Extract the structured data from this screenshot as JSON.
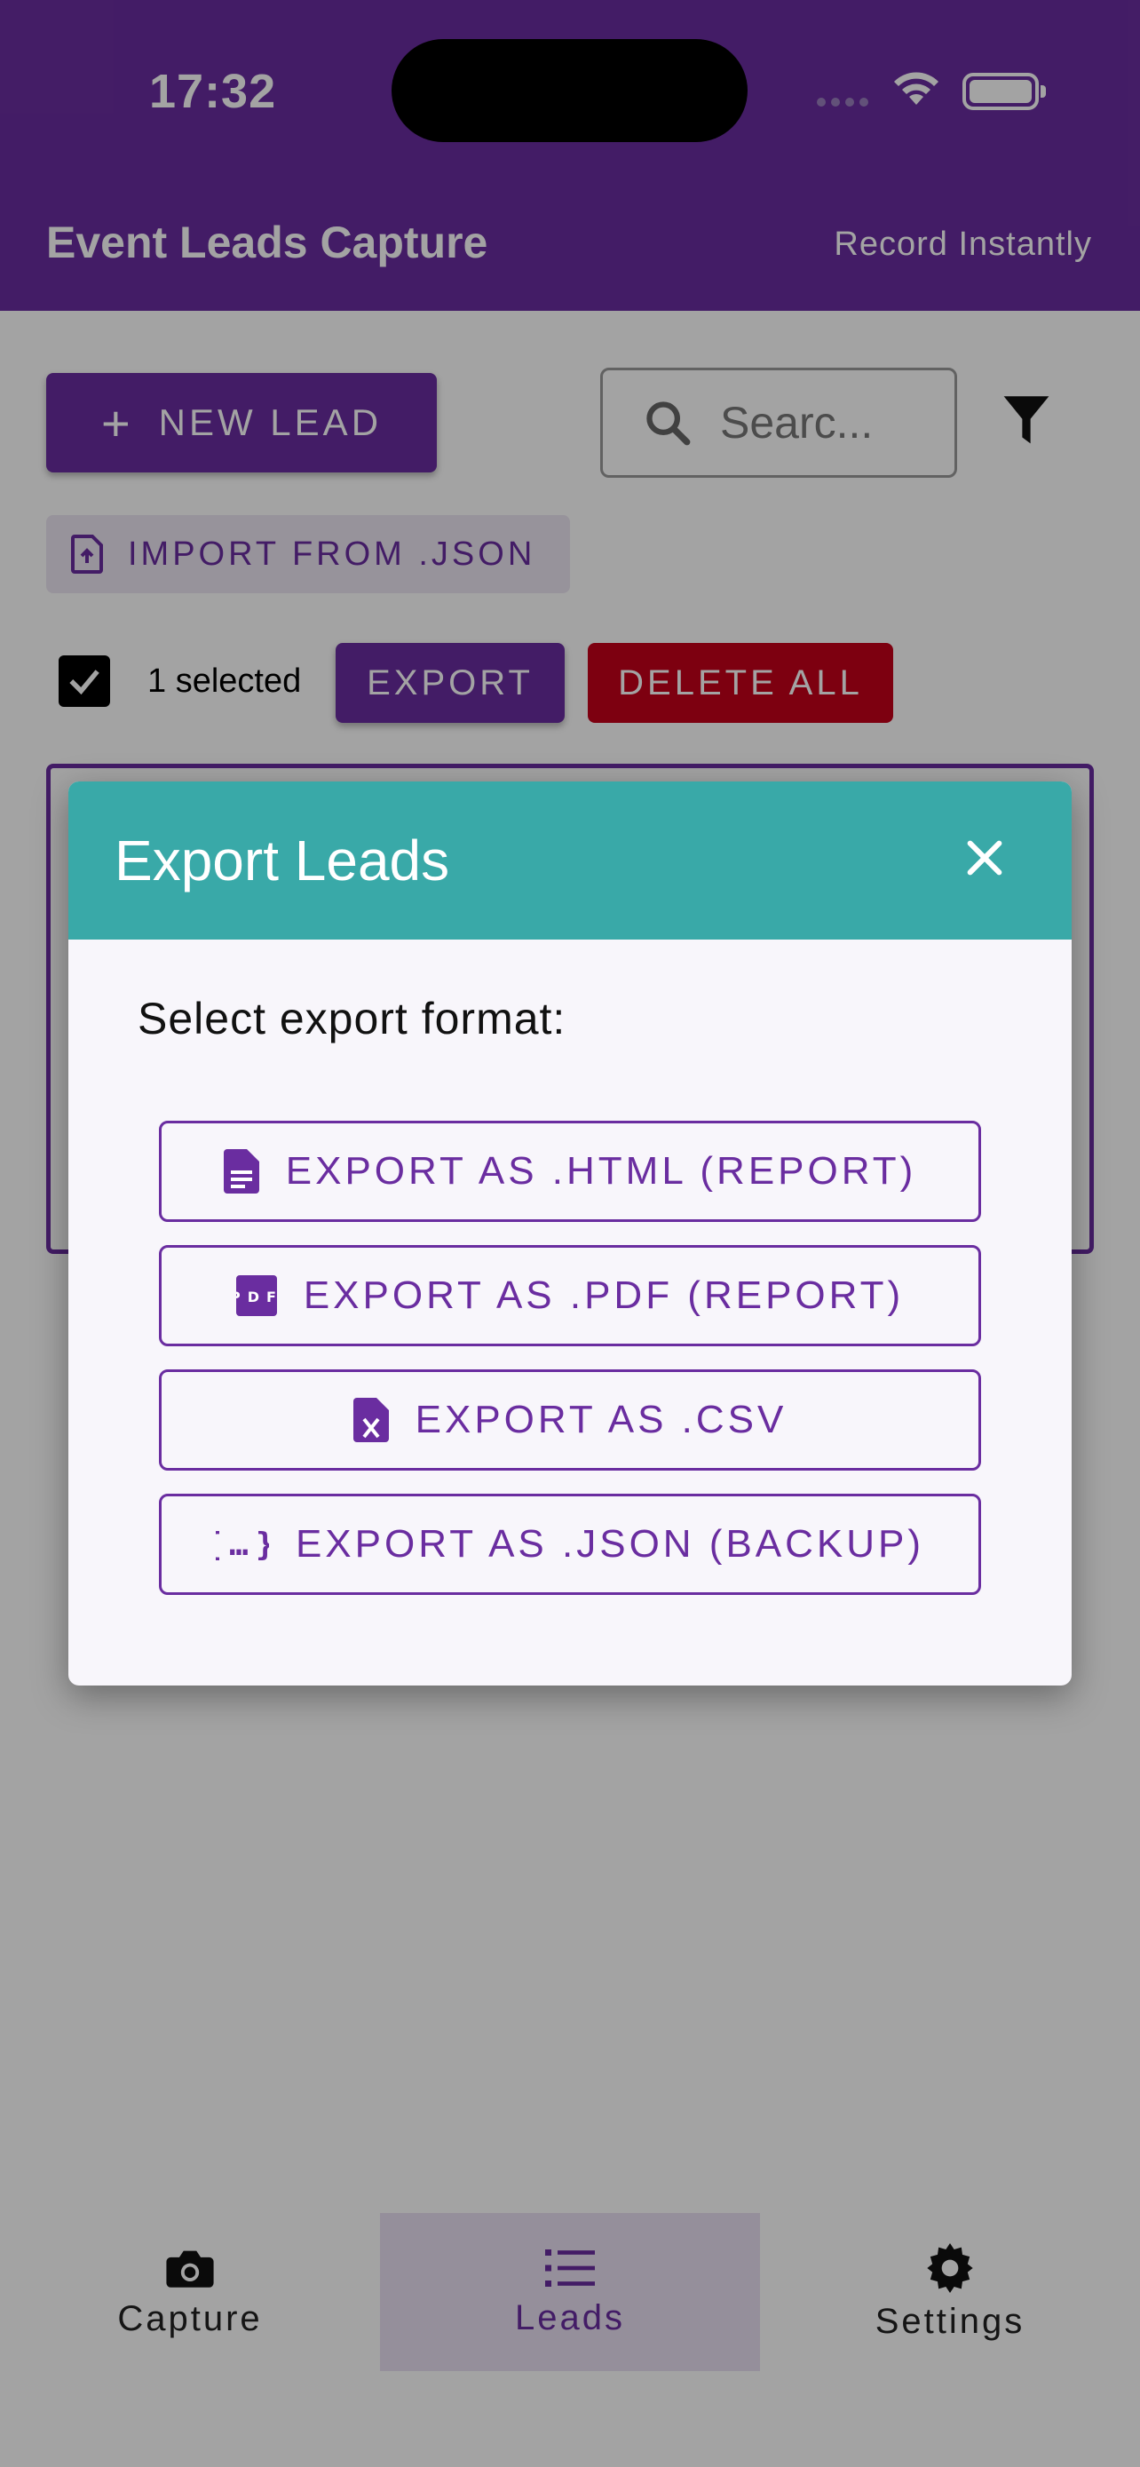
{
  "status_bar": {
    "time": "17:32"
  },
  "header": {
    "title": "Event Leads Capture",
    "subtitle": "Record Instantly"
  },
  "toolbar": {
    "new_lead_label": "NEW LEAD",
    "search_placeholder": "Searc...",
    "import_label": "IMPORT FROM .JSON",
    "selected_text": "1 selected",
    "export_label": "EXPORT",
    "delete_all_label": "DELETE ALL"
  },
  "modal": {
    "title": "Export Leads",
    "prompt": "Select export format:",
    "options": [
      {
        "label": "EXPORT AS .HTML (REPORT)",
        "icon": "document-icon"
      },
      {
        "label": "EXPORT AS .PDF (REPORT)",
        "icon": "pdf-icon"
      },
      {
        "label": "EXPORT AS .CSV",
        "icon": "spreadsheet-file-icon"
      },
      {
        "label": "EXPORT AS .JSON (BACKUP)",
        "icon": "json-braces-icon"
      }
    ]
  },
  "bottom_nav": {
    "items": [
      {
        "label": "Capture",
        "icon": "camera-icon"
      },
      {
        "label": "Leads",
        "icon": "list-icon",
        "active": true
      },
      {
        "label": "Settings",
        "icon": "gear-icon"
      }
    ]
  },
  "colors": {
    "primary": "#6a2da0",
    "modal_header": "#39a9a8",
    "danger": "#c4001a"
  }
}
